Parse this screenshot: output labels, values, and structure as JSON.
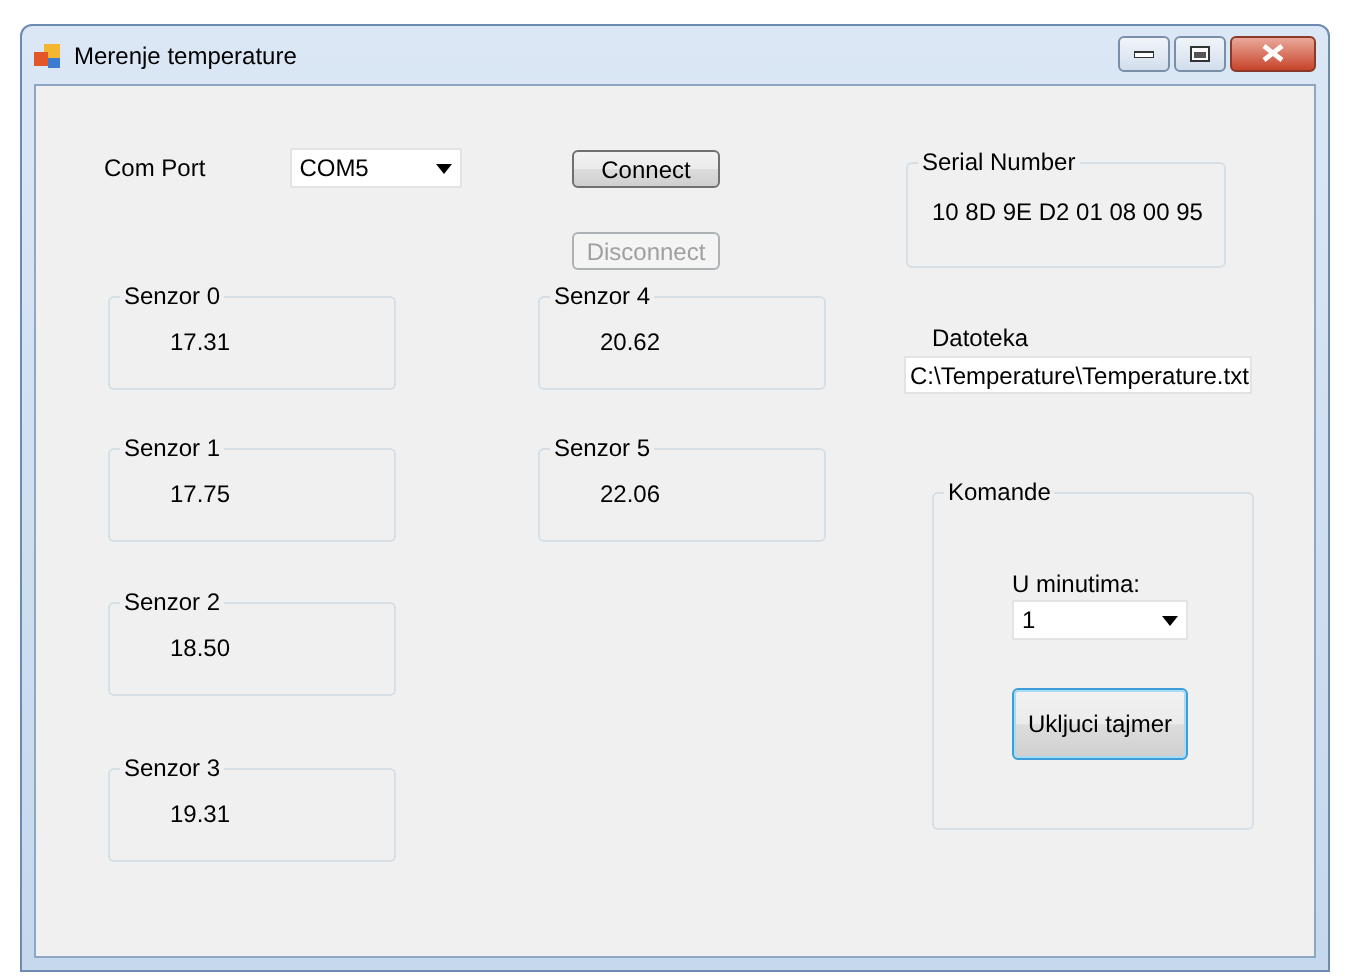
{
  "window": {
    "title": "Merenje temperature"
  },
  "com_port": {
    "label": "Com Port",
    "value": "COM5"
  },
  "buttons": [
    {
      "label": "Connect",
      "disabled": false
    },
    {
      "label": "Disconnect",
      "disabled": true
    }
  ],
  "serial_number": {
    "title": "Serial Number",
    "value": "10 8D 9E D2 01 08 00 95"
  },
  "file": {
    "label": "Datoteka",
    "value": "C:\\Temperature\\Temperature.txt"
  },
  "sensors": [
    {
      "name": "Senzor 0",
      "value": "17.31"
    },
    {
      "name": "Senzor 1",
      "value": "17.75"
    },
    {
      "name": "Senzor 2",
      "value": "18.50"
    },
    {
      "name": "Senzor 3",
      "value": "19.31"
    },
    {
      "name": "Senzor 4",
      "value": "20.62"
    },
    {
      "name": "Senzor 5",
      "value": "22.06"
    }
  ],
  "commands": {
    "title": "Komande",
    "interval_label": "U minutima:",
    "interval_value": "1",
    "start_button": "Ukljuci tajmer"
  }
}
